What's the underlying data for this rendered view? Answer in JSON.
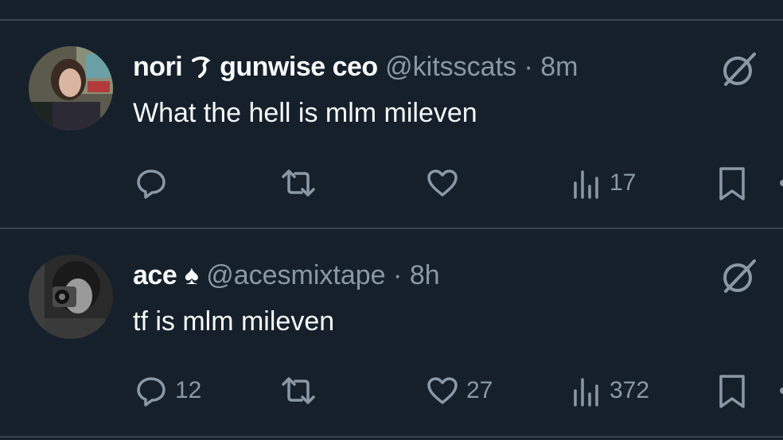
{
  "tweets": [
    {
      "name": "nori",
      "name_emoji": "ඉ",
      "name_suffix": "gunwise ceo",
      "handle": "@kitsscats",
      "separator": "·",
      "time": "8m",
      "text": "What the hell is mlm mileven",
      "reply_count": "",
      "retweet_count": "",
      "like_count": "",
      "view_count": "17"
    },
    {
      "name": "ace",
      "name_emoji": "♠",
      "name_suffix": "",
      "handle": "@acesmixtape",
      "separator": "·",
      "time": "8h",
      "text": "tf is mlm mileven",
      "reply_count": "12",
      "retweet_count": "",
      "like_count": "27",
      "view_count": "372"
    }
  ],
  "colors": {
    "background": "#15202b",
    "text": "#f7f9f9",
    "muted": "#8b98a5",
    "divider": "#38444d"
  },
  "icons": [
    "reply-icon",
    "retweet-icon",
    "like-icon",
    "views-icon",
    "bookmark-icon",
    "grok-icon"
  ]
}
